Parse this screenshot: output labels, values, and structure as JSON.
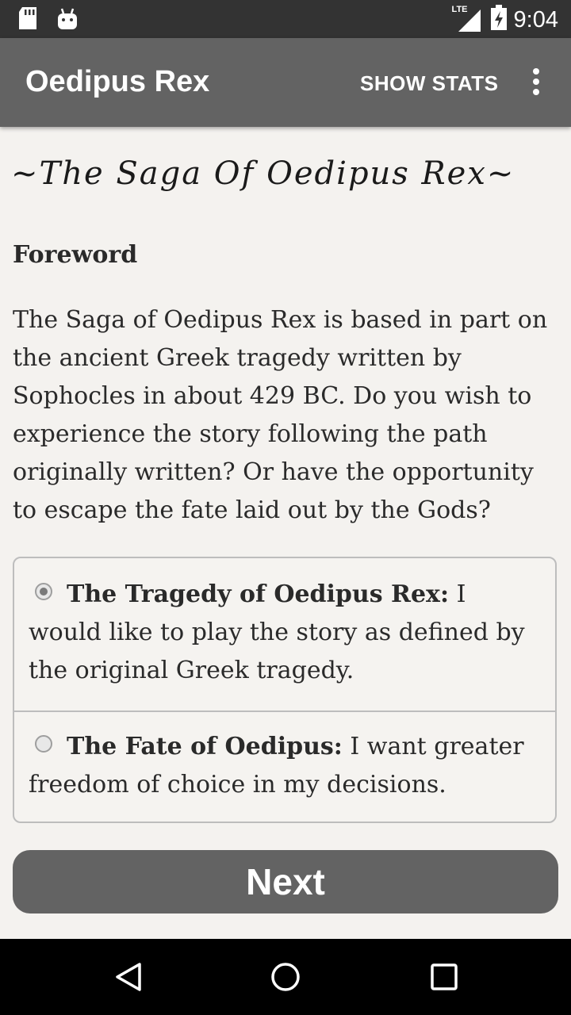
{
  "status_bar": {
    "time": "9:04",
    "network": "LTE",
    "icons": [
      "sd-card-icon",
      "android-icon",
      "lte-signal-icon",
      "battery-charging-icon"
    ]
  },
  "app_bar": {
    "title": "Oedipus Rex",
    "show_stats_label": "SHOW STATS",
    "overflow_icon": "overflow-menu-icon"
  },
  "content": {
    "saga_title": "~The Saga Of Oedipus Rex~",
    "foreword_heading": "Foreword",
    "intro_text": "The Saga of Oedipus Rex is based in part on the ancient Greek tragedy written by Sophocles in about 429 BC. Do you wish to experience the story following the path originally written? Or have the opportunity to escape the fate laid out by the Gods?",
    "choices": [
      {
        "title": "The Tragedy of Oedipus Rex:",
        "text": " I would like to play the story as defined by the original Greek tragedy.",
        "selected": true
      },
      {
        "title": "The Fate of Oedipus:",
        "text": " I want greater freedom of choice in my decisions.",
        "selected": false
      }
    ],
    "next_label": "Next"
  },
  "nav_bar": {
    "icons": [
      "back-icon",
      "home-icon",
      "recents-icon"
    ]
  },
  "colors": {
    "status_bar": "#333333",
    "app_bar": "#636363",
    "background": "#f4f2ef",
    "button": "#636363"
  }
}
